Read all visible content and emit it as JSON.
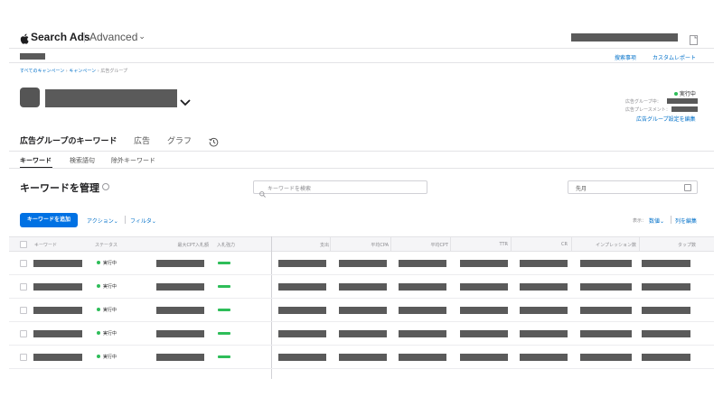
{
  "header": {
    "brand": "Search Ads",
    "tier": "Advanced",
    "tier_chevron": "⌄",
    "nav_links": [
      "搜索事项",
      "カスタムレポート"
    ]
  },
  "breadcrumb": [
    "すべてのキャンペーン",
    "キャンペーン",
    "広告グループ"
  ],
  "breadcrumb_sep": "›",
  "adgroup": {
    "status": "実行中",
    "meta_labels": [
      "広告グループ中：",
      "広告プレースメント："
    ],
    "edit_link": "広告グループ設定を編集",
    "chevron": "⌄"
  },
  "tabs": {
    "primary": [
      "広告グループのキーワード",
      "広告",
      "グラフ"
    ],
    "history_icon": "history-icon",
    "secondary": [
      "キーワード",
      "検索語句",
      "除外キーワード"
    ]
  },
  "section": {
    "title": "キーワードを管理",
    "search_placeholder": "キーワードを検索",
    "date_value": "先月"
  },
  "toolbar": {
    "add_button": "キーワードを追加",
    "actions": "アクション",
    "filter": "フィルタ",
    "right_prefix": "表示：",
    "right_view": "数値",
    "edit_columns": "列を編集",
    "chevron": "⌄"
  },
  "table": {
    "headers": [
      "キーワード",
      "ステータス",
      "最大CPT入札額",
      "入札強力",
      "支出",
      "平均CPA",
      "平均CPT",
      "TTR",
      "CR",
      "インプレッション数",
      "タップ数"
    ],
    "rows": [
      {
        "status": "実行中"
      },
      {
        "status": "実行中"
      },
      {
        "status": "実行中"
      },
      {
        "status": "実行中"
      },
      {
        "status": "実行中"
      }
    ]
  },
  "colors": {
    "accent": "#0071e3",
    "link": "#0070c9",
    "running": "#2ebd59",
    "redacted": "#5a5a5a"
  }
}
